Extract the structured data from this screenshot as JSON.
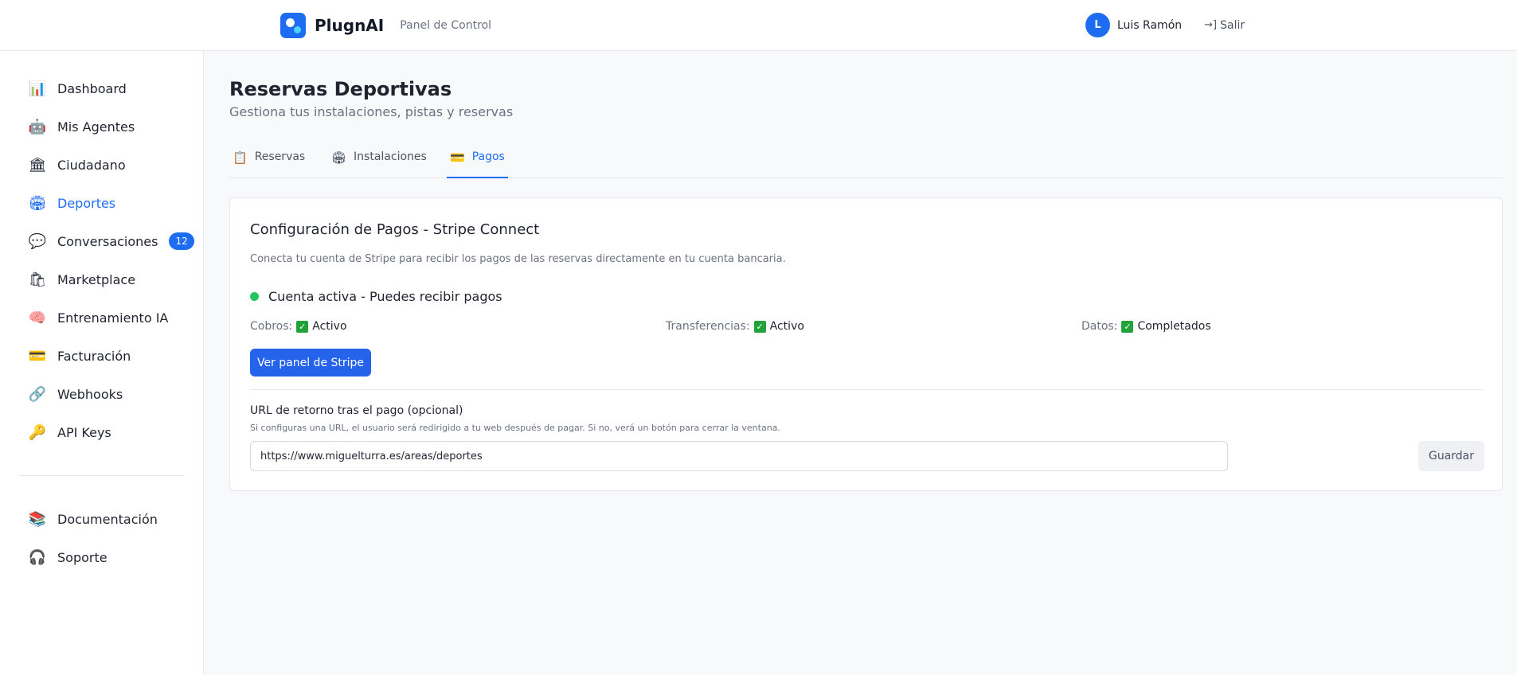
{
  "header": {
    "brand_name": "PlugnAI",
    "brand_sub": "Panel de Control",
    "user_initial": "L",
    "user_name": "Luis Ramón",
    "logout_label": "Salir"
  },
  "sidebar": {
    "items": [
      {
        "label": "Dashboard",
        "icon": "bar-chart-icon"
      },
      {
        "label": "Mis Agentes",
        "icon": "robot-icon"
      },
      {
        "label": "Ciudadano",
        "icon": "bank-icon"
      },
      {
        "label": "Deportes",
        "icon": "stadium-icon",
        "active": true
      },
      {
        "label": "Conversaciones",
        "icon": "chat-icon",
        "badge": "12"
      },
      {
        "label": "Marketplace",
        "icon": "shopping-bag-icon"
      },
      {
        "label": "Entrenamiento IA",
        "icon": "brain-icon"
      },
      {
        "label": "Facturación",
        "icon": "credit-card-icon"
      },
      {
        "label": "Webhooks",
        "icon": "link-icon"
      },
      {
        "label": "API Keys",
        "icon": "key-icon"
      }
    ],
    "footer_items": [
      {
        "label": "Documentación",
        "icon": "books-icon"
      },
      {
        "label": "Soporte",
        "icon": "headphones-icon"
      }
    ]
  },
  "page": {
    "title": "Reservas Deportivas",
    "subtitle": "Gestiona tus instalaciones, pistas y reservas"
  },
  "tabs": [
    {
      "label": "Reservas",
      "icon": "clipboard-icon"
    },
    {
      "label": "Instalaciones",
      "icon": "stadium-icon"
    },
    {
      "label": "Pagos",
      "icon": "credit-card-icon",
      "active": true
    }
  ],
  "payments": {
    "title": "Configuración de Pagos - Stripe Connect",
    "description": "Conecta tu cuenta de Stripe para recibir los pagos de las reservas directamente en tu cuenta bancaria.",
    "status_text": "Cuenta activa - Puedes recibir pagos",
    "status_color": "#22c55e",
    "checks": [
      {
        "label": "Cobros:",
        "value": "Activo"
      },
      {
        "label": "Transferencias:",
        "value": "Activo"
      },
      {
        "label": "Datos:",
        "value": "Completados"
      }
    ],
    "stripe_button": "Ver panel de Stripe",
    "url_label": "URL de retorno tras el pago (opcional)",
    "url_help": "Si configuras una URL, el usuario será redirigido a tu web después de pagar. Si no, verá un botón para cerrar la ventana.",
    "url_value": "https://www.miguelturra.es/areas/deportes",
    "save_button": "Guardar"
  },
  "colors": {
    "accent": "#1d6cf2",
    "check": "#21a33a"
  }
}
